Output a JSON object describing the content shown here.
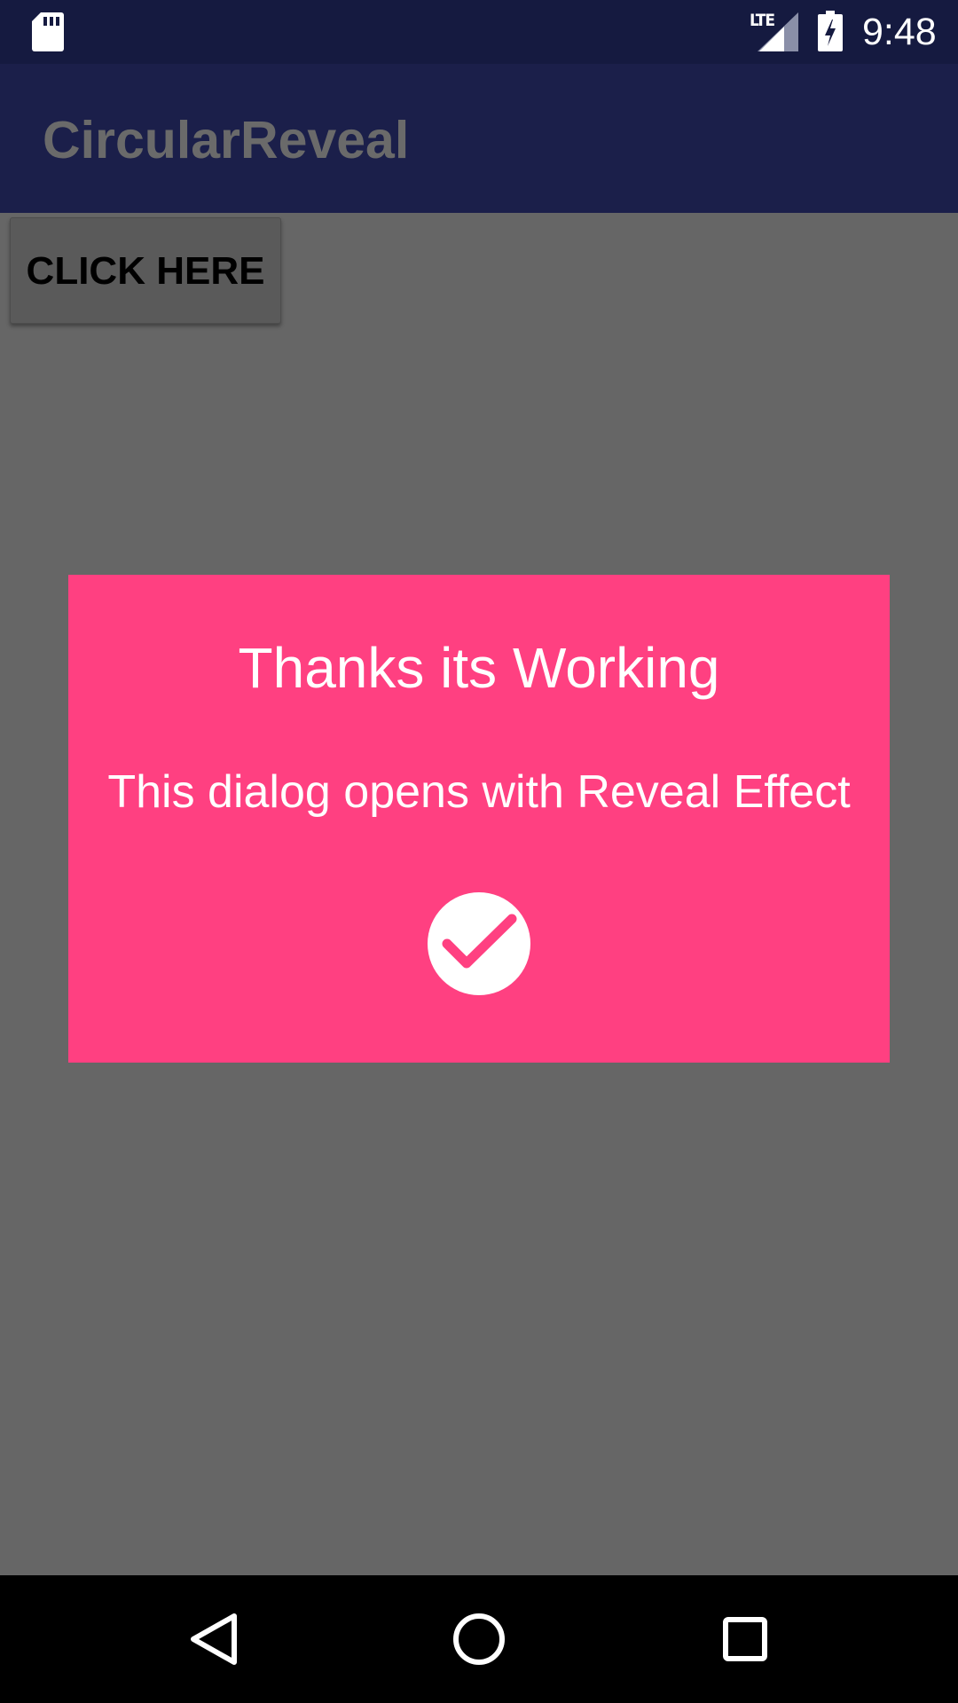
{
  "status_bar": {
    "time": "9:48",
    "network_label": "LTE",
    "icons": [
      "sd-card-icon",
      "signal-icon",
      "battery-charging-icon"
    ]
  },
  "app_bar": {
    "title": "CircularReveal"
  },
  "main": {
    "button_label": "CLICK HERE"
  },
  "dialog": {
    "title": "Thanks its Working",
    "message": "This dialog opens with Reveal Effect",
    "icon": "check-circle-icon"
  },
  "nav_bar": {
    "icons": [
      "back-icon",
      "home-icon",
      "recents-icon"
    ]
  },
  "colors": {
    "status_bar": "#151a40",
    "app_bar": "#1b1f4a",
    "scrim_background": "#666666",
    "dialog_accent": "#ff4081",
    "nav_bar": "#000000"
  }
}
